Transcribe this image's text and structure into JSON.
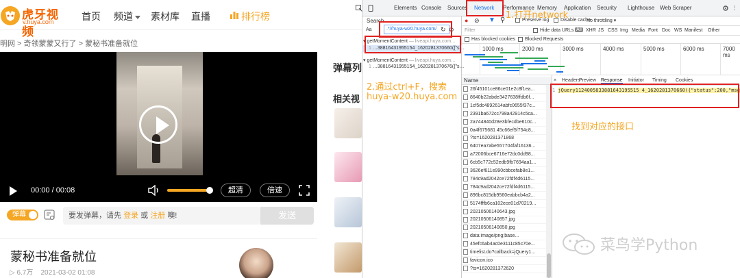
{
  "site": {
    "logo_text": "虎牙视频",
    "logo_sub": "v.huya.com",
    "nav": [
      "首页",
      "频道",
      "素材库",
      "直播",
      "排行榜"
    ],
    "breadcrumb": "明网 > 奇领蒙蒙又行了 > 蒙秘书准备就位",
    "player": {
      "time": "00:00 / 00:08",
      "quality": "超清",
      "speed": "倍速",
      "volume_pct": 90
    },
    "danmu": {
      "toggle": "弹幕",
      "hint_pre": "要发弹幕，请先",
      "login": "登录",
      "or": "或",
      "register": "注册",
      "hint_post": "噢!",
      "send": "发送"
    },
    "video": {
      "title": "蒙秘书准备就位",
      "views": "6.7万",
      "date": "2021-03-02 01:08"
    },
    "side": {
      "danmu_list": "弹幕列",
      "related": "相关视"
    }
  },
  "devtools": {
    "tabs": [
      "Elements",
      "Console",
      "Sources",
      "Network",
      "Performance",
      "Memory",
      "Application",
      "Security",
      "Lighthouse",
      "Web Scraper"
    ],
    "search_label": "Search",
    "search_query": ".*//huya-w20.huya.com/",
    "results": [
      {
        "name": "getMomentContent",
        "host": "— liveapi.huya.com…"
      },
      {
        "line": "1",
        "text": "…38816431955154_1620281370660({\"s…"
      },
      {
        "name": "getMomentContent",
        "host": "— liveapi.huya.com…"
      },
      {
        "line": "1",
        "text": "…38816431955154_1620281370676({\"s…"
      }
    ],
    "toolbar": {
      "preserve_log": "Preserve log",
      "disable_cache": "Disable cache",
      "throttle": "No throttling"
    },
    "filter": {
      "placeholder": "Filter",
      "hide_data_urls": "Hide data URLs",
      "types": [
        "All",
        "XHR",
        "JS",
        "CSS",
        "Img",
        "Media",
        "Font",
        "Doc",
        "WS",
        "Manifest",
        "Other"
      ],
      "has_blocked_cookies": "Has blocked cookies",
      "blocked_requests": "Blocked Requests"
    },
    "timeline_ticks": [
      "1000 ms",
      "2000 ms",
      "3000 ms",
      "4000 ms",
      "5000 ms",
      "6000 ms",
      "7000 ms"
    ],
    "list_header": "Name",
    "requests": [
      "26f45101ce86ce01e2c8f1ea...",
      "8640b22abde3427638ffdb6f...",
      "1cf5dc4892614abfc0655f37c...",
      "2391ba672cc798a42914c5ca...",
      "2a744840d28e3bfecdbe610c...",
      "0a4f675681 45c66ef5f754c8...",
      "?ts=1620281371868",
      "6407ea7abe557704faf16136...",
      "a72006bce6716e72dc0dd98...",
      "6cb5c772c52edb9fb7694aa1...",
      "3626ef611e990cbbcefab8e1...",
      "784c9ad2042ce72fdf4d6115...",
      "784c9ad2042ce72fdf4d6115...",
      "896bc815db9560eabbcb4a2...",
      "5174fffb6ca102ece01d70219...",
      "20210506140643.jpg",
      "20210506140857.jpg",
      "20210506140850.jpg",
      "data:image/png;base...",
      "45efc6ab4ac0e3111c85c70e...",
      "timelist.do?callback=jQuery1...",
      "favicon.ico",
      "?ts=1620281372620"
    ],
    "detail_tabs": [
      "Headers",
      "Preview",
      "Response",
      "Initiator",
      "Timing",
      "Cookies"
    ],
    "response_line_no": "1",
    "response_text": "jQuery1124005833881643195515 4_1620281370660({\"status\":200,\"msg\":\"\",\"da"
  },
  "annotations": {
    "step1": "1.打开network",
    "step2_line1": "2.通过ctrl+F，搜索",
    "step2_line2": "huya-w20.huya.com",
    "step3": "找到对应的接口",
    "watermark": "菜鸟学Python"
  },
  "colors": {
    "accent": "#f5a623",
    "brand": "#f56500",
    "annotation": "#e02020",
    "devtools_blue": "#1a73e8"
  }
}
